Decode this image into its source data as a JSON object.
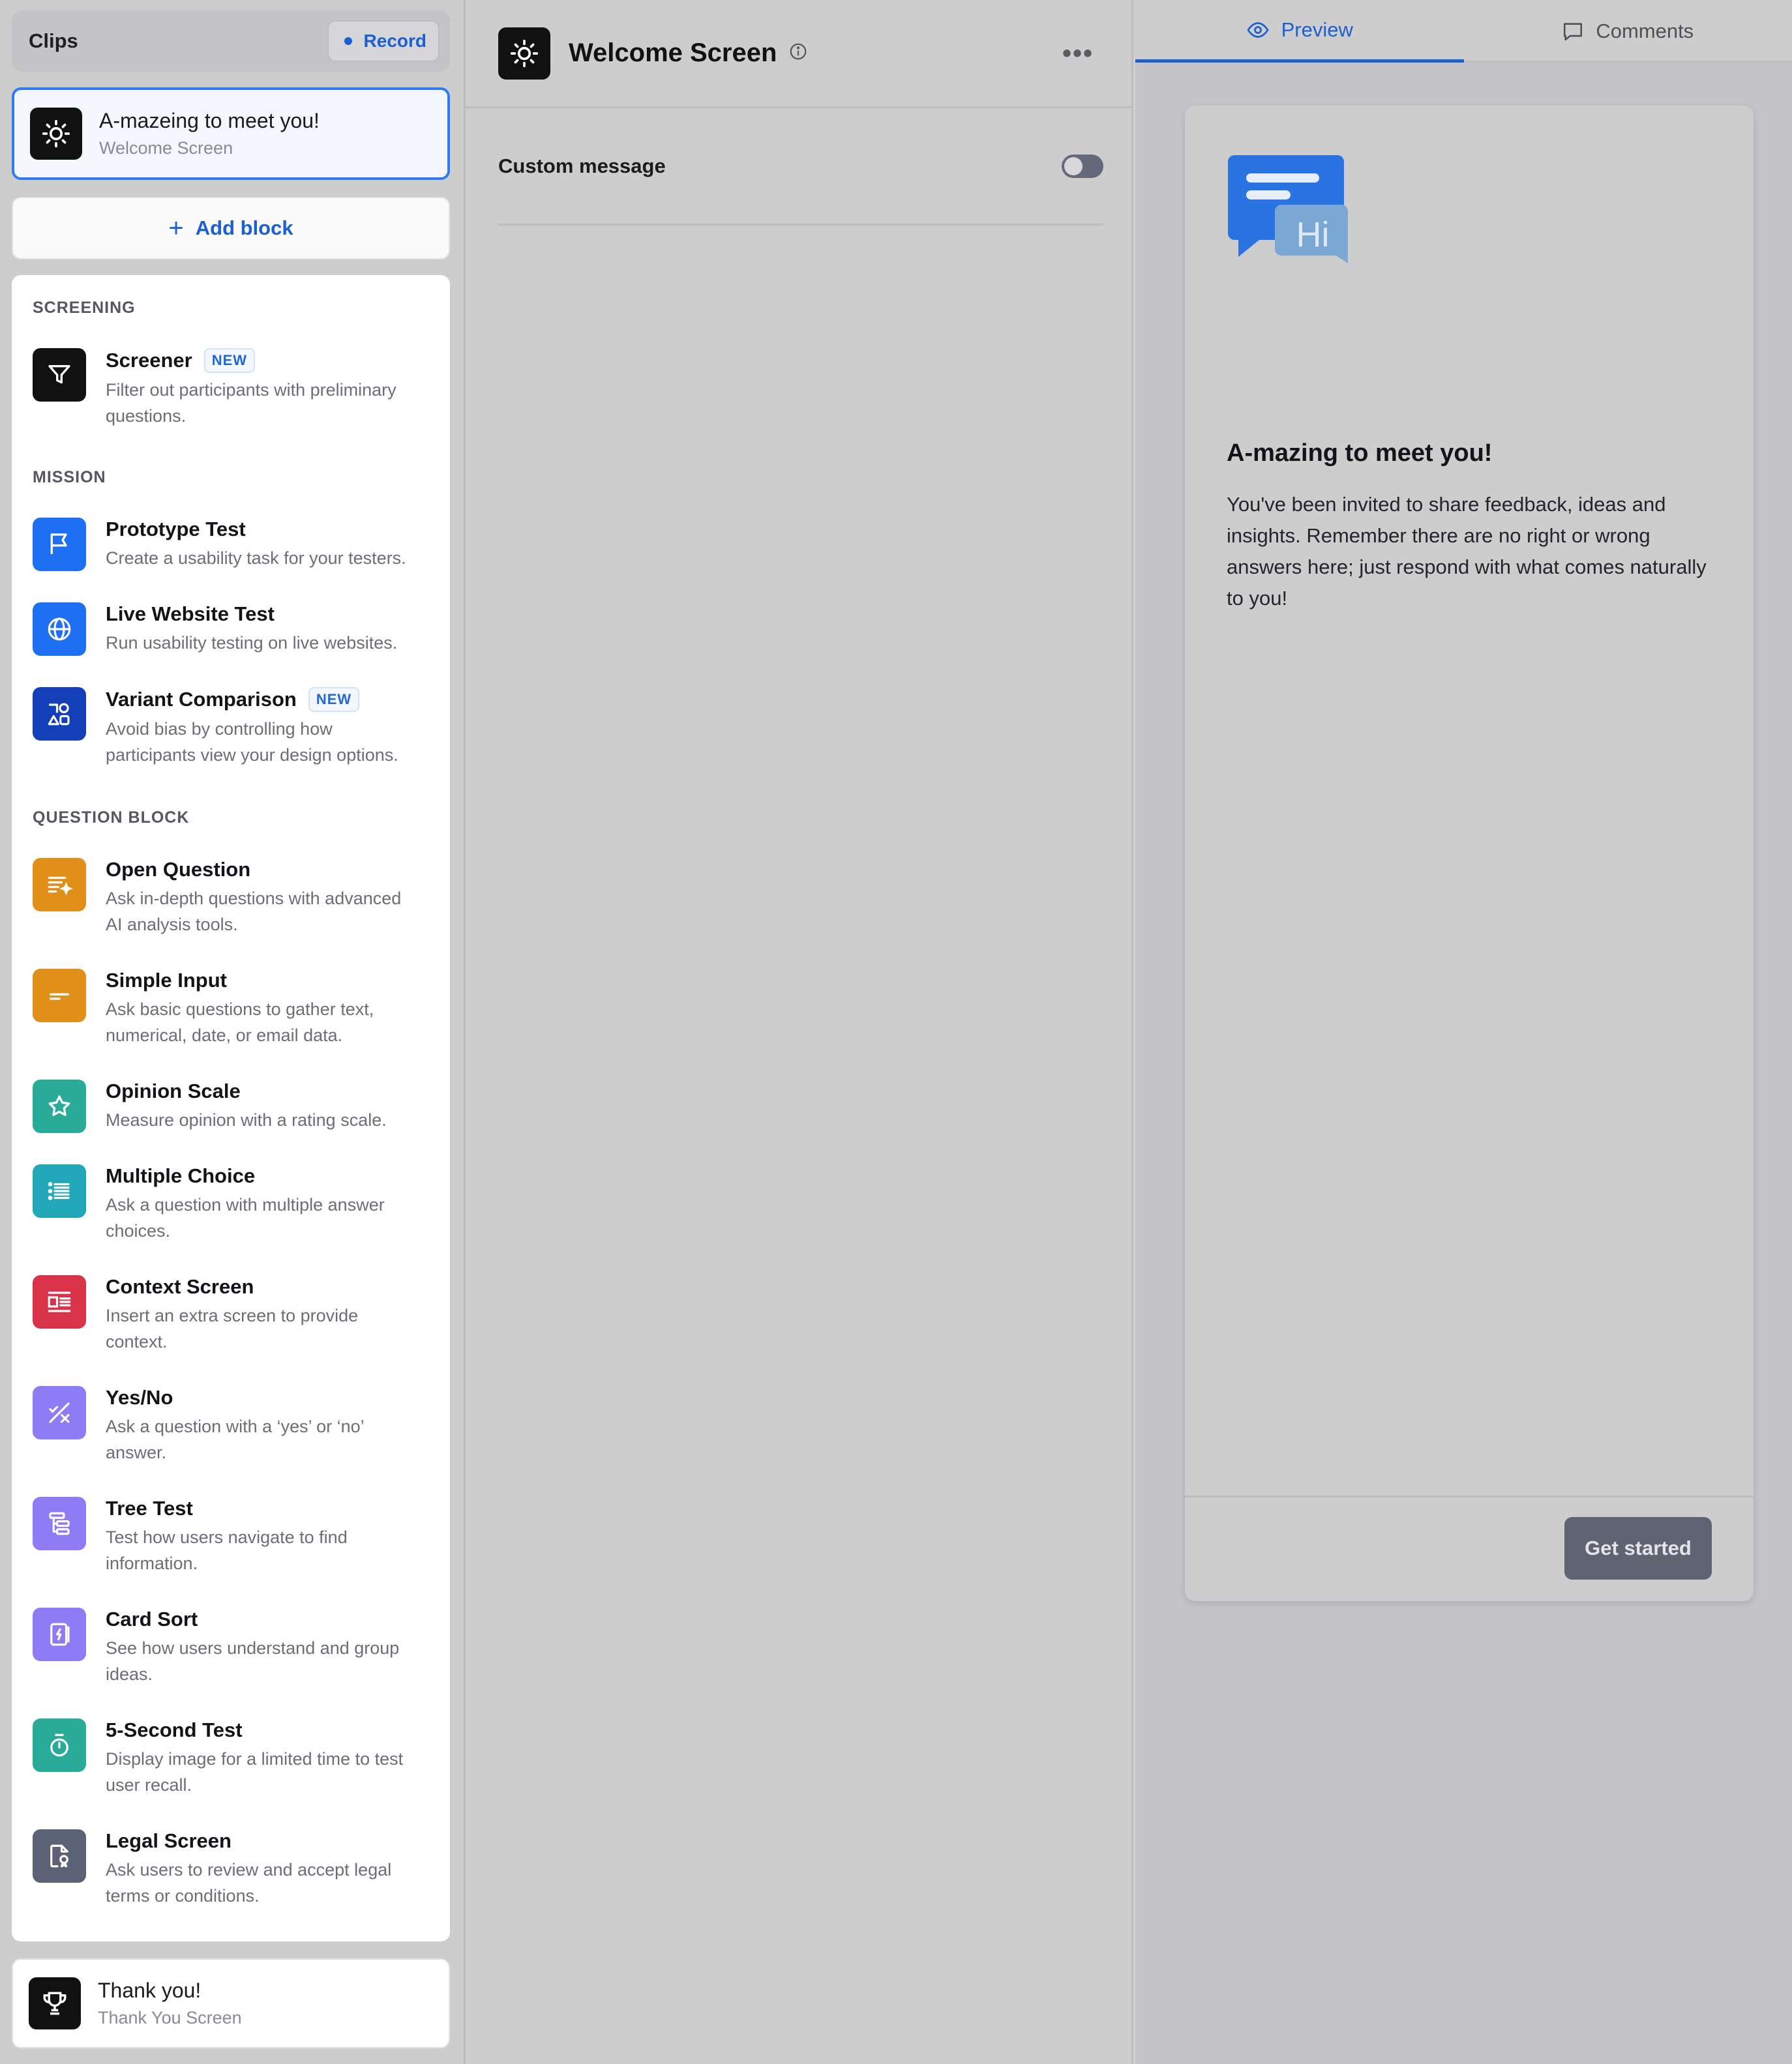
{
  "sidebar": {
    "clips_title": "Clips",
    "record_label": "Record",
    "welcome_card": {
      "title": "A-mazeing to meet you!",
      "subtitle": "Welcome Screen"
    },
    "add_block_label": "Add block",
    "sections": {
      "screening": "SCREENING",
      "mission": "MISSION",
      "question_block": "QUESTION BLOCK"
    },
    "badge_new": "NEW",
    "blocks": [
      {
        "title": "Screener",
        "desc1": "Filter out participants with preliminary",
        "desc2": "questions.",
        "icon": "funnel-icon",
        "color": "#111111"
      },
      {
        "title": "Prototype Test",
        "desc1": "Create a usability task for your testers.",
        "desc2": "",
        "icon": "flag-icon",
        "color": "#1f6ff2"
      },
      {
        "title": "Live Website Test",
        "desc1": "Run usability testing on live websites.",
        "desc2": "",
        "icon": "globe-icon",
        "color": "#1f6ff2"
      },
      {
        "title": "Variant Comparison",
        "desc1": "Avoid bias by controlling how",
        "desc2": "participants view your design options.",
        "icon": "shapes-icon",
        "color": "#1340b8"
      },
      {
        "title": "Open Question",
        "desc1": "Ask in-depth questions with advanced",
        "desc2": "AI analysis tools.",
        "icon": "text-sparkle-icon",
        "color": "#e08f18"
      },
      {
        "title": "Simple Input",
        "desc1": "Ask basic questions to gather text,",
        "desc2": "numerical, date, or email data.",
        "icon": "input-line-icon",
        "color": "#e08f18"
      },
      {
        "title": "Opinion Scale",
        "desc1": "Measure opinion with a rating scale.",
        "desc2": "",
        "icon": "star-icon",
        "color": "#2aab9a"
      },
      {
        "title": "Multiple Choice",
        "desc1": "Ask a question with multiple answer",
        "desc2": "choices.",
        "icon": "list-icon",
        "color": "#22a7b8"
      },
      {
        "title": "Context Screen",
        "desc1": "Insert an extra screen to provide",
        "desc2": "context.",
        "icon": "context-icon",
        "color": "#d9334a"
      },
      {
        "title": "Yes/No",
        "desc1": "Ask a question with a ‘yes’ or ‘no’",
        "desc2": "answer.",
        "icon": "yes-no-icon",
        "color": "#8d7cf3"
      },
      {
        "title": "Tree Test",
        "desc1": "Test how users navigate to find",
        "desc2": "information.",
        "icon": "tree-icon",
        "color": "#8d7cf3"
      },
      {
        "title": "Card Sort",
        "desc1": "See how users understand and group",
        "desc2": "ideas.",
        "icon": "card-icon",
        "color": "#8d7cf3"
      },
      {
        "title": "5-Second Test",
        "desc1": "Display image for a limited time to test",
        "desc2": "user recall.",
        "icon": "timer-icon",
        "color": "#2aab9a"
      },
      {
        "title": "Legal Screen",
        "desc1": "Ask users to review and accept legal",
        "desc2": "terms or conditions.",
        "icon": "legal-doc-icon",
        "color": "#5b6275"
      }
    ],
    "thanks_card": {
      "title": "Thank you!",
      "subtitle": "Thank You Screen"
    }
  },
  "middle": {
    "title": "Welcome Screen",
    "more_label": "•••",
    "custom_message_label": "Custom message",
    "custom_message_enabled": false
  },
  "right": {
    "tabs": {
      "preview": "Preview",
      "comments": "Comments"
    },
    "preview": {
      "illustration_text": "Hi",
      "title": "A-mazing to meet you!",
      "body": "You've been invited to share feedback, ideas and insights. Remember there are no right or wrong answers here; just respond with what comes naturally to you!",
      "cta": "Get started"
    }
  },
  "colors": {
    "accent": "#1c5fd0",
    "selected_border": "#2f7cf2",
    "badge_text": "#2567d8"
  }
}
